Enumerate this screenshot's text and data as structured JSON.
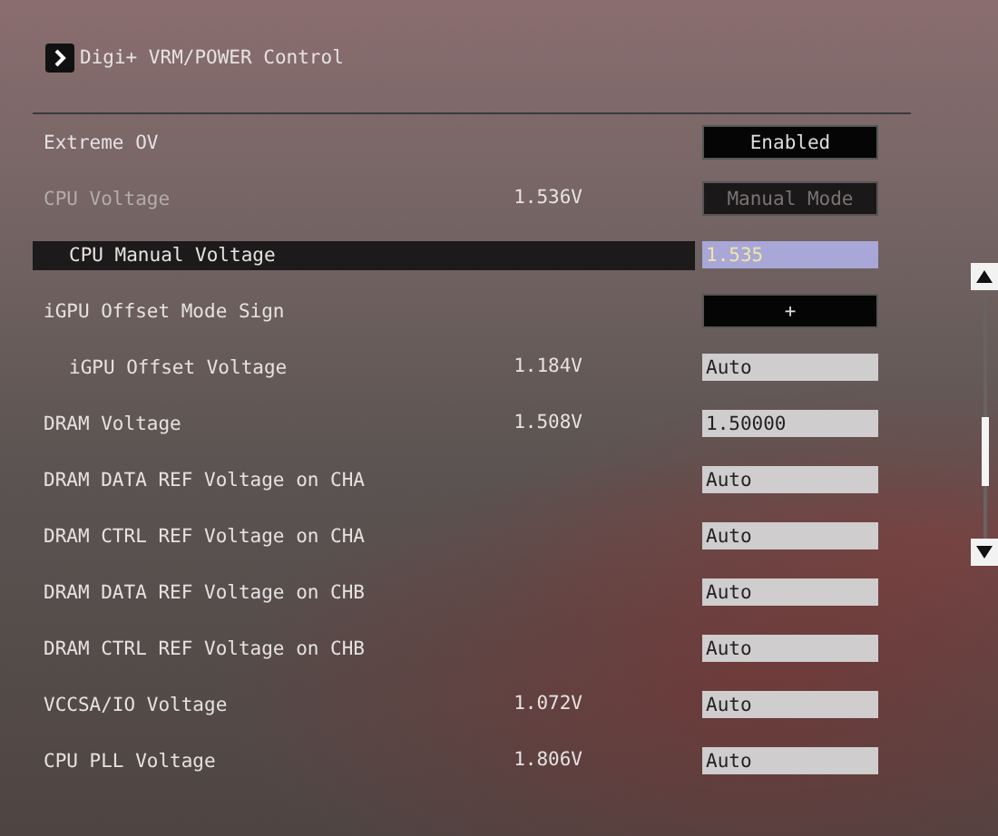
{
  "header": {
    "title": "Digi+ VRM/POWER Control"
  },
  "rows": [
    {
      "label": "Extreme OV",
      "kind": "dropdown",
      "value": "Enabled",
      "selected": false,
      "disabled": false
    },
    {
      "label": "CPU Voltage",
      "reading": "1.536V",
      "kind": "dropdown",
      "value": "Manual Mode",
      "selected": false,
      "disabled": true,
      "children": [
        {
          "label": "CPU Manual Voltage",
          "kind": "field",
          "value": "1.535",
          "selected": true,
          "disabled": false
        }
      ]
    },
    {
      "label": "iGPU Offset Mode Sign",
      "kind": "dropdown",
      "value": "+",
      "selected": false,
      "disabled": false,
      "children": [
        {
          "label": "iGPU Offset Voltage",
          "reading": "1.184V",
          "kind": "field",
          "value": "Auto",
          "selected": false,
          "disabled": false
        }
      ]
    },
    {
      "label": "DRAM Voltage",
      "reading": "1.508V",
      "kind": "field",
      "value": "1.50000",
      "selected": false,
      "disabled": false
    },
    {
      "label": "DRAM DATA REF Voltage on CHA",
      "kind": "field",
      "value": "Auto",
      "selected": false,
      "disabled": false
    },
    {
      "label": "DRAM CTRL REF Voltage on CHA",
      "kind": "field",
      "value": "Auto",
      "selected": false,
      "disabled": false
    },
    {
      "label": "DRAM DATA REF Voltage on CHB",
      "kind": "field",
      "value": "Auto",
      "selected": false,
      "disabled": false
    },
    {
      "label": "DRAM CTRL REF Voltage on CHB",
      "kind": "field",
      "value": "Auto",
      "selected": false,
      "disabled": false
    },
    {
      "label": "VCCSA/IO Voltage",
      "reading": "1.072V",
      "kind": "field",
      "value": "Auto",
      "selected": false,
      "disabled": false
    },
    {
      "label": "CPU PLL Voltage",
      "reading": "1.806V",
      "kind": "field",
      "value": "Auto",
      "selected": false,
      "disabled": false
    }
  ]
}
